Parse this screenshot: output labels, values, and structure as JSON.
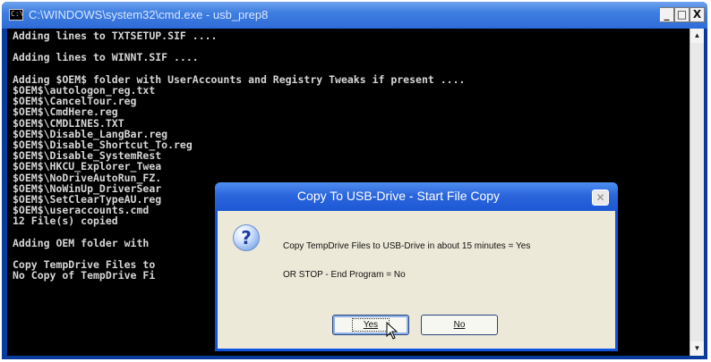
{
  "window": {
    "title": "C:\\WINDOWS\\system32\\cmd.exe - usb_prep8",
    "minimize": "_",
    "maximize": "□",
    "close": "X"
  },
  "console": {
    "text": "Adding lines to TXTSETUP.SIF ....\n\nAdding lines to WINNT.SIF ....\n\nAdding $OEM$ folder with UserAccounts and Registry Tweaks if present ....\n$OEM$\\autologon_reg.txt\n$OEM$\\CancelTour.reg\n$OEM$\\CmdHere.reg\n$OEM$\\CMDLINES.TXT\n$OEM$\\Disable_LangBar.reg\n$OEM$\\Disable_Shortcut_To.reg\n$OEM$\\Disable_SystemRest\n$OEM$\\HKCU_Explorer_Twea\n$OEM$\\NoDriveAutoRun_FZ.\n$OEM$\\NoWinUp_DriverSear\n$OEM$\\SetClearTypeAU.reg\n$OEM$\\useraccounts.cmd\n12 File(s) copied\n\nAdding OEM folder with\n\nCopy TempDrive Files to\nNo Copy of TempDrive Fi"
  },
  "dialog": {
    "title": "Copy To USB-Drive - Start File Copy",
    "close": "✕",
    "icon": "question-icon",
    "line1": "Copy TempDrive Files to USB-Drive in about 15 minutes = Yes",
    "line2": "OR  STOP - End Program  =  No",
    "yes": "Yes",
    "no": "No"
  },
  "colors": {
    "title_bar": "#2f6bd8",
    "console_bg": "#000000",
    "console_text": "#d6d6d6",
    "dialog_face": "#ece9d8"
  }
}
